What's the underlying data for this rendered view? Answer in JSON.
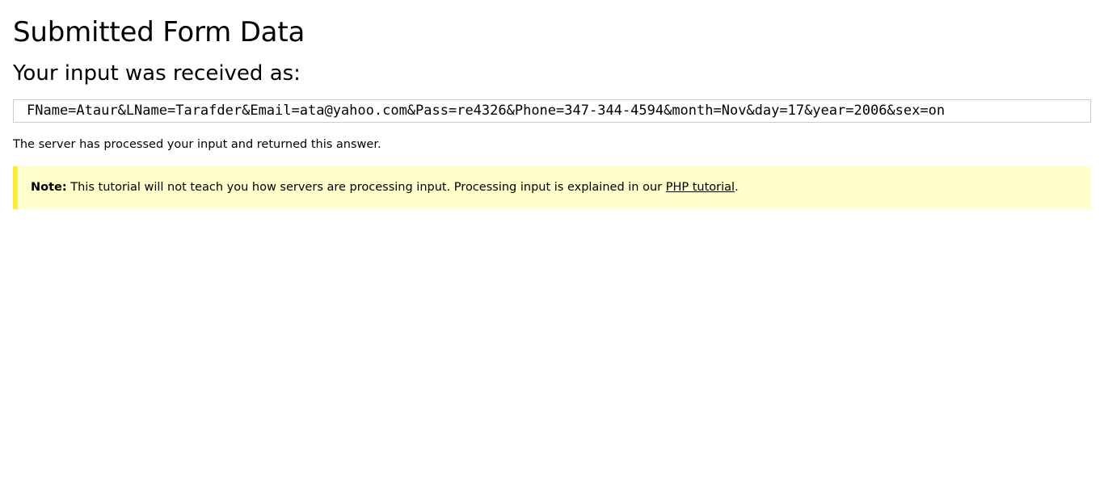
{
  "page_title": "Submitted Form Data",
  "subheading": "Your input was received as:",
  "result_text": "FName=Ataur&LName=Tarafder&Email=ata@yahoo.com&Pass=re4326&Phone=347-344-4594&month=Nov&day=17&year=2006&sex=on",
  "server_message": "The server has processed your input and returned this answer.",
  "note": {
    "label": "Note:",
    "text": " This tutorial will not teach you how servers are processing input. Processing input is explained in our ",
    "link_text": "PHP tutorial",
    "trailing": "."
  },
  "colors": {
    "note_background": "#ffffcc",
    "note_border": "#ffeb3b",
    "result_border": "#cccccc"
  }
}
